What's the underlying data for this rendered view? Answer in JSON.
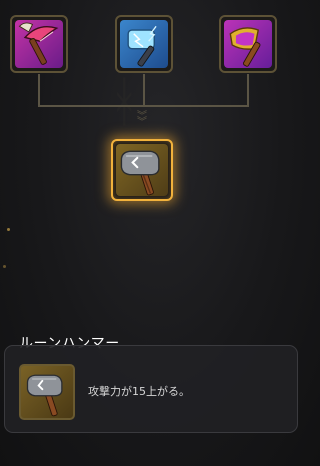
{
  "skill_tree": {
    "nodes": [
      {
        "icon": "pickaxe-icon",
        "color": "#b0309f"
      },
      {
        "icon": "lightning-hammer-icon",
        "color": "#2f78c4"
      },
      {
        "icon": "golden-axe-icon",
        "color": "#b030b0"
      }
    ],
    "selected": {
      "icon": "rune-hammer-icon",
      "highlight_color": "#f2b23c"
    }
  },
  "detail_panel": {
    "title": "ルーンハンマー",
    "icon": "rune-hammer-icon",
    "description": "攻撃力が15上がる。"
  }
}
